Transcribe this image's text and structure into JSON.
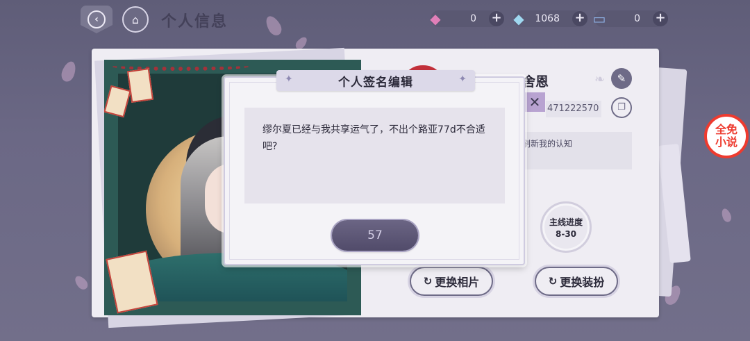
{
  "header": {
    "title": "个人信息",
    "back_icon": "back-arrow-icon",
    "home_icon": "home-icon"
  },
  "currencies": [
    {
      "icon": "pink-gem-icon",
      "value": "0"
    },
    {
      "icon": "diamond-icon",
      "value": "1068"
    },
    {
      "icon": "ticket-icon",
      "value": "0"
    }
  ],
  "profile": {
    "name": "舍恩",
    "uid": "471222570",
    "signature_tail": "刷新我的认知",
    "progress_label": "主线进度",
    "progress_value": "8-30",
    "change_photo_label": "更换相片",
    "change_outfit_label": "更换装扮"
  },
  "dialog": {
    "title": "个人签名编辑",
    "signature_text": "缪尔夏已经与我共享运气了，不出个路亚77d不合适吧?",
    "char_count": "57"
  },
  "badge": {
    "line1": "全免",
    "line2": "小说"
  },
  "colors": {
    "accent": "#6b6584",
    "panel": "#efedf3",
    "badge_red": "#ee3b2f"
  }
}
